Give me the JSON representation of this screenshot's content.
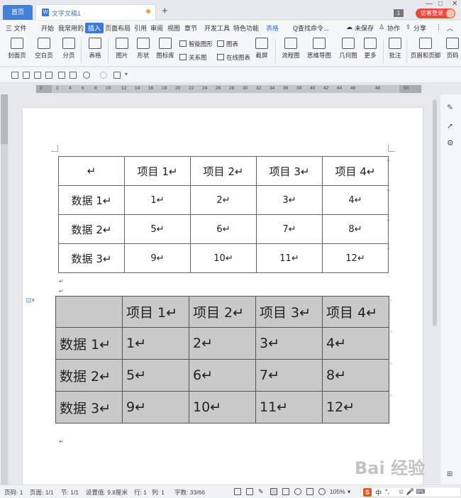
{
  "tabs": {
    "home": "首页",
    "document": "文字文稿1",
    "new_tab": "+"
  },
  "titlebar": {
    "badge": "1",
    "login": "访客登录"
  },
  "menu": {
    "file": "三 文件",
    "items": [
      "开始",
      "我常用的",
      "插入",
      "页面布局",
      "引用",
      "审阅",
      "视图",
      "章节",
      "开发工具",
      "特色功能",
      "表格"
    ],
    "active_index": 2,
    "search": "Q查找命令...",
    "unsaved": "未保存",
    "collab": "协作",
    "share": "分享"
  },
  "ribbon": {
    "big_buttons": [
      "封面页",
      "空白页",
      "分页",
      "表格",
      "图片",
      "形状",
      "图标库",
      "流程图",
      "思维导图",
      "几何图",
      "更多",
      "批注",
      "页眉和页脚",
      "页码"
    ],
    "small_buttons": [
      "智能图形",
      "图表",
      "关系图",
      "在线图表",
      "截屏"
    ]
  },
  "ruler": {
    "ticks": [
      "2",
      "2",
      "4",
      "6",
      "8",
      "10",
      "12",
      "14",
      "16",
      "18",
      "20",
      "22",
      "24",
      "26",
      "28",
      "30",
      "32",
      "34",
      "36",
      "38",
      "40",
      "42",
      "44",
      "46",
      "48",
      "50"
    ]
  },
  "table1": {
    "header": [
      "↵",
      "项目 1↵",
      "项目 2↵",
      "项目 3↵",
      "项目 4↵"
    ],
    "rows": [
      [
        "数据 1↵",
        "1↵",
        "2↵",
        "3↵",
        "4↵"
      ],
      [
        "数据 2↵",
        "5↵",
        "6↵",
        "7↵",
        "8↵"
      ],
      [
        "数据 3↵",
        "9↵",
        "10↵",
        "11↵",
        "12↵"
      ]
    ]
  },
  "table2": {
    "header": [
      "",
      "项目 1↵",
      "项目 2↵",
      "项目 3↵",
      "项目 4↵"
    ],
    "rows": [
      [
        "数据 1↵",
        "1↵",
        "2↵",
        "3↵",
        "4↵"
      ],
      [
        "数据 2↵",
        "5↵",
        "6↵",
        "7↵",
        "8↵"
      ],
      [
        "数据 3↵",
        "9↵",
        "10↵",
        "11↵",
        "12↵"
      ]
    ],
    "fill_color": "#c9c9c9"
  },
  "paragraph_mark": "↵",
  "status": {
    "page": "页码: 1",
    "pages": "页面: 1/1",
    "section": "节: 1/1",
    "setting": "设置值: 9.8厘米",
    "row": "行: 1",
    "col": "列: 1",
    "words": "字数: 33/66",
    "zoom": "105%"
  },
  "sogou": {
    "lang": "中",
    "punct": "°,",
    "icons": "☺ 🎤 ⌨"
  },
  "watermark": "Bai 经验"
}
